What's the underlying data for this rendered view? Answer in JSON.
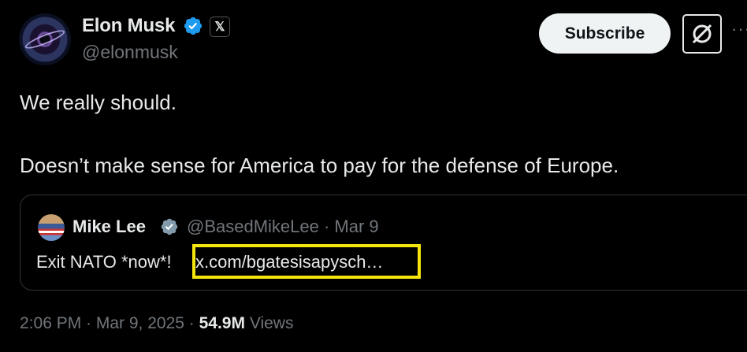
{
  "author": {
    "name": "Elon Musk",
    "handle": "@elonmusk",
    "x_badge": "𝕏"
  },
  "actions": {
    "subscribe_label": "Subscribe",
    "more_label": "···"
  },
  "tweet": {
    "line1": "We really should.",
    "line2": "Doesn’t make sense for America to pay for the defense of Europe."
  },
  "quoted": {
    "name": "Mike Lee",
    "handle_date": "@BasedMikeLee · Mar 9",
    "text": "Exit NATO *now*!",
    "link": "x.com/bgatesisapysch…",
    "highlight_color": "#f5e50d"
  },
  "meta": {
    "time_date": "2:06 PM · Mar 9, 2025 · ",
    "views_count": "54.9M",
    "views_label": " Views"
  },
  "colors": {
    "background": "#000000",
    "verified_blue": "#1d9bf0",
    "muted_text": "#71767b",
    "primary_text": "#e7e9ea"
  }
}
